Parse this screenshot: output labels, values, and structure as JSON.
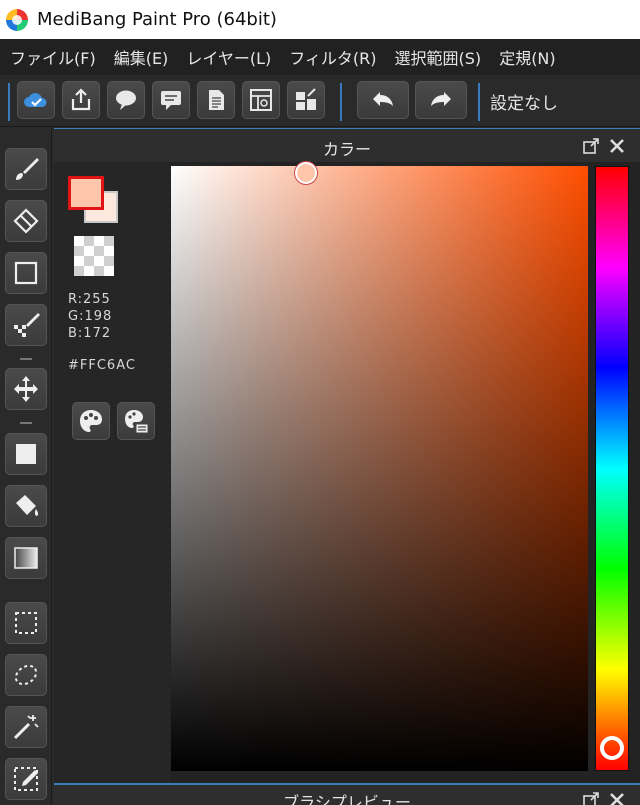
{
  "window": {
    "title": "MediBang Paint Pro (64bit)"
  },
  "menu": {
    "items": [
      {
        "label": "ファイル(F)"
      },
      {
        "label": "編集(E)"
      },
      {
        "label": "レイヤー(L)"
      },
      {
        "label": "フィルタ(R)"
      },
      {
        "label": "選択範囲(S)"
      },
      {
        "label": "定規(N)"
      }
    ]
  },
  "toolbar": {
    "buttons": [
      {
        "icon": "cloud-check-icon"
      },
      {
        "icon": "upload-icon"
      },
      {
        "icon": "speech-bubble-icon"
      },
      {
        "icon": "comment-icon"
      },
      {
        "icon": "document-icon"
      },
      {
        "icon": "storyboard-icon"
      },
      {
        "icon": "panel-settings-icon"
      },
      {
        "icon": "undo-icon"
      },
      {
        "icon": "redo-icon"
      }
    ],
    "preset_label": "設定なし"
  },
  "tools": [
    {
      "icon": "brush-icon"
    },
    {
      "icon": "eraser-icon"
    },
    {
      "icon": "rectangle-icon"
    },
    {
      "icon": "dot-brush-icon"
    },
    {
      "icon": "move-icon"
    },
    {
      "icon": "fill-rect-icon"
    },
    {
      "icon": "bucket-icon"
    },
    {
      "icon": "gradient-icon"
    },
    {
      "icon": "select-rect-icon"
    },
    {
      "icon": "lasso-icon"
    },
    {
      "icon": "magic-wand-icon"
    },
    {
      "icon": "select-pen-icon"
    }
  ],
  "color_panel": {
    "title": "カラー",
    "foreground_color": "#FFC6AC",
    "background_color": "#FDE8DD",
    "r_label": "R:255",
    "g_label": "G:198",
    "b_label": "B:172",
    "hex_label": "#FFC6AC",
    "hue_color": "#FF4E00"
  },
  "brush_preview_panel": {
    "title": "ブラシプレビュー"
  }
}
